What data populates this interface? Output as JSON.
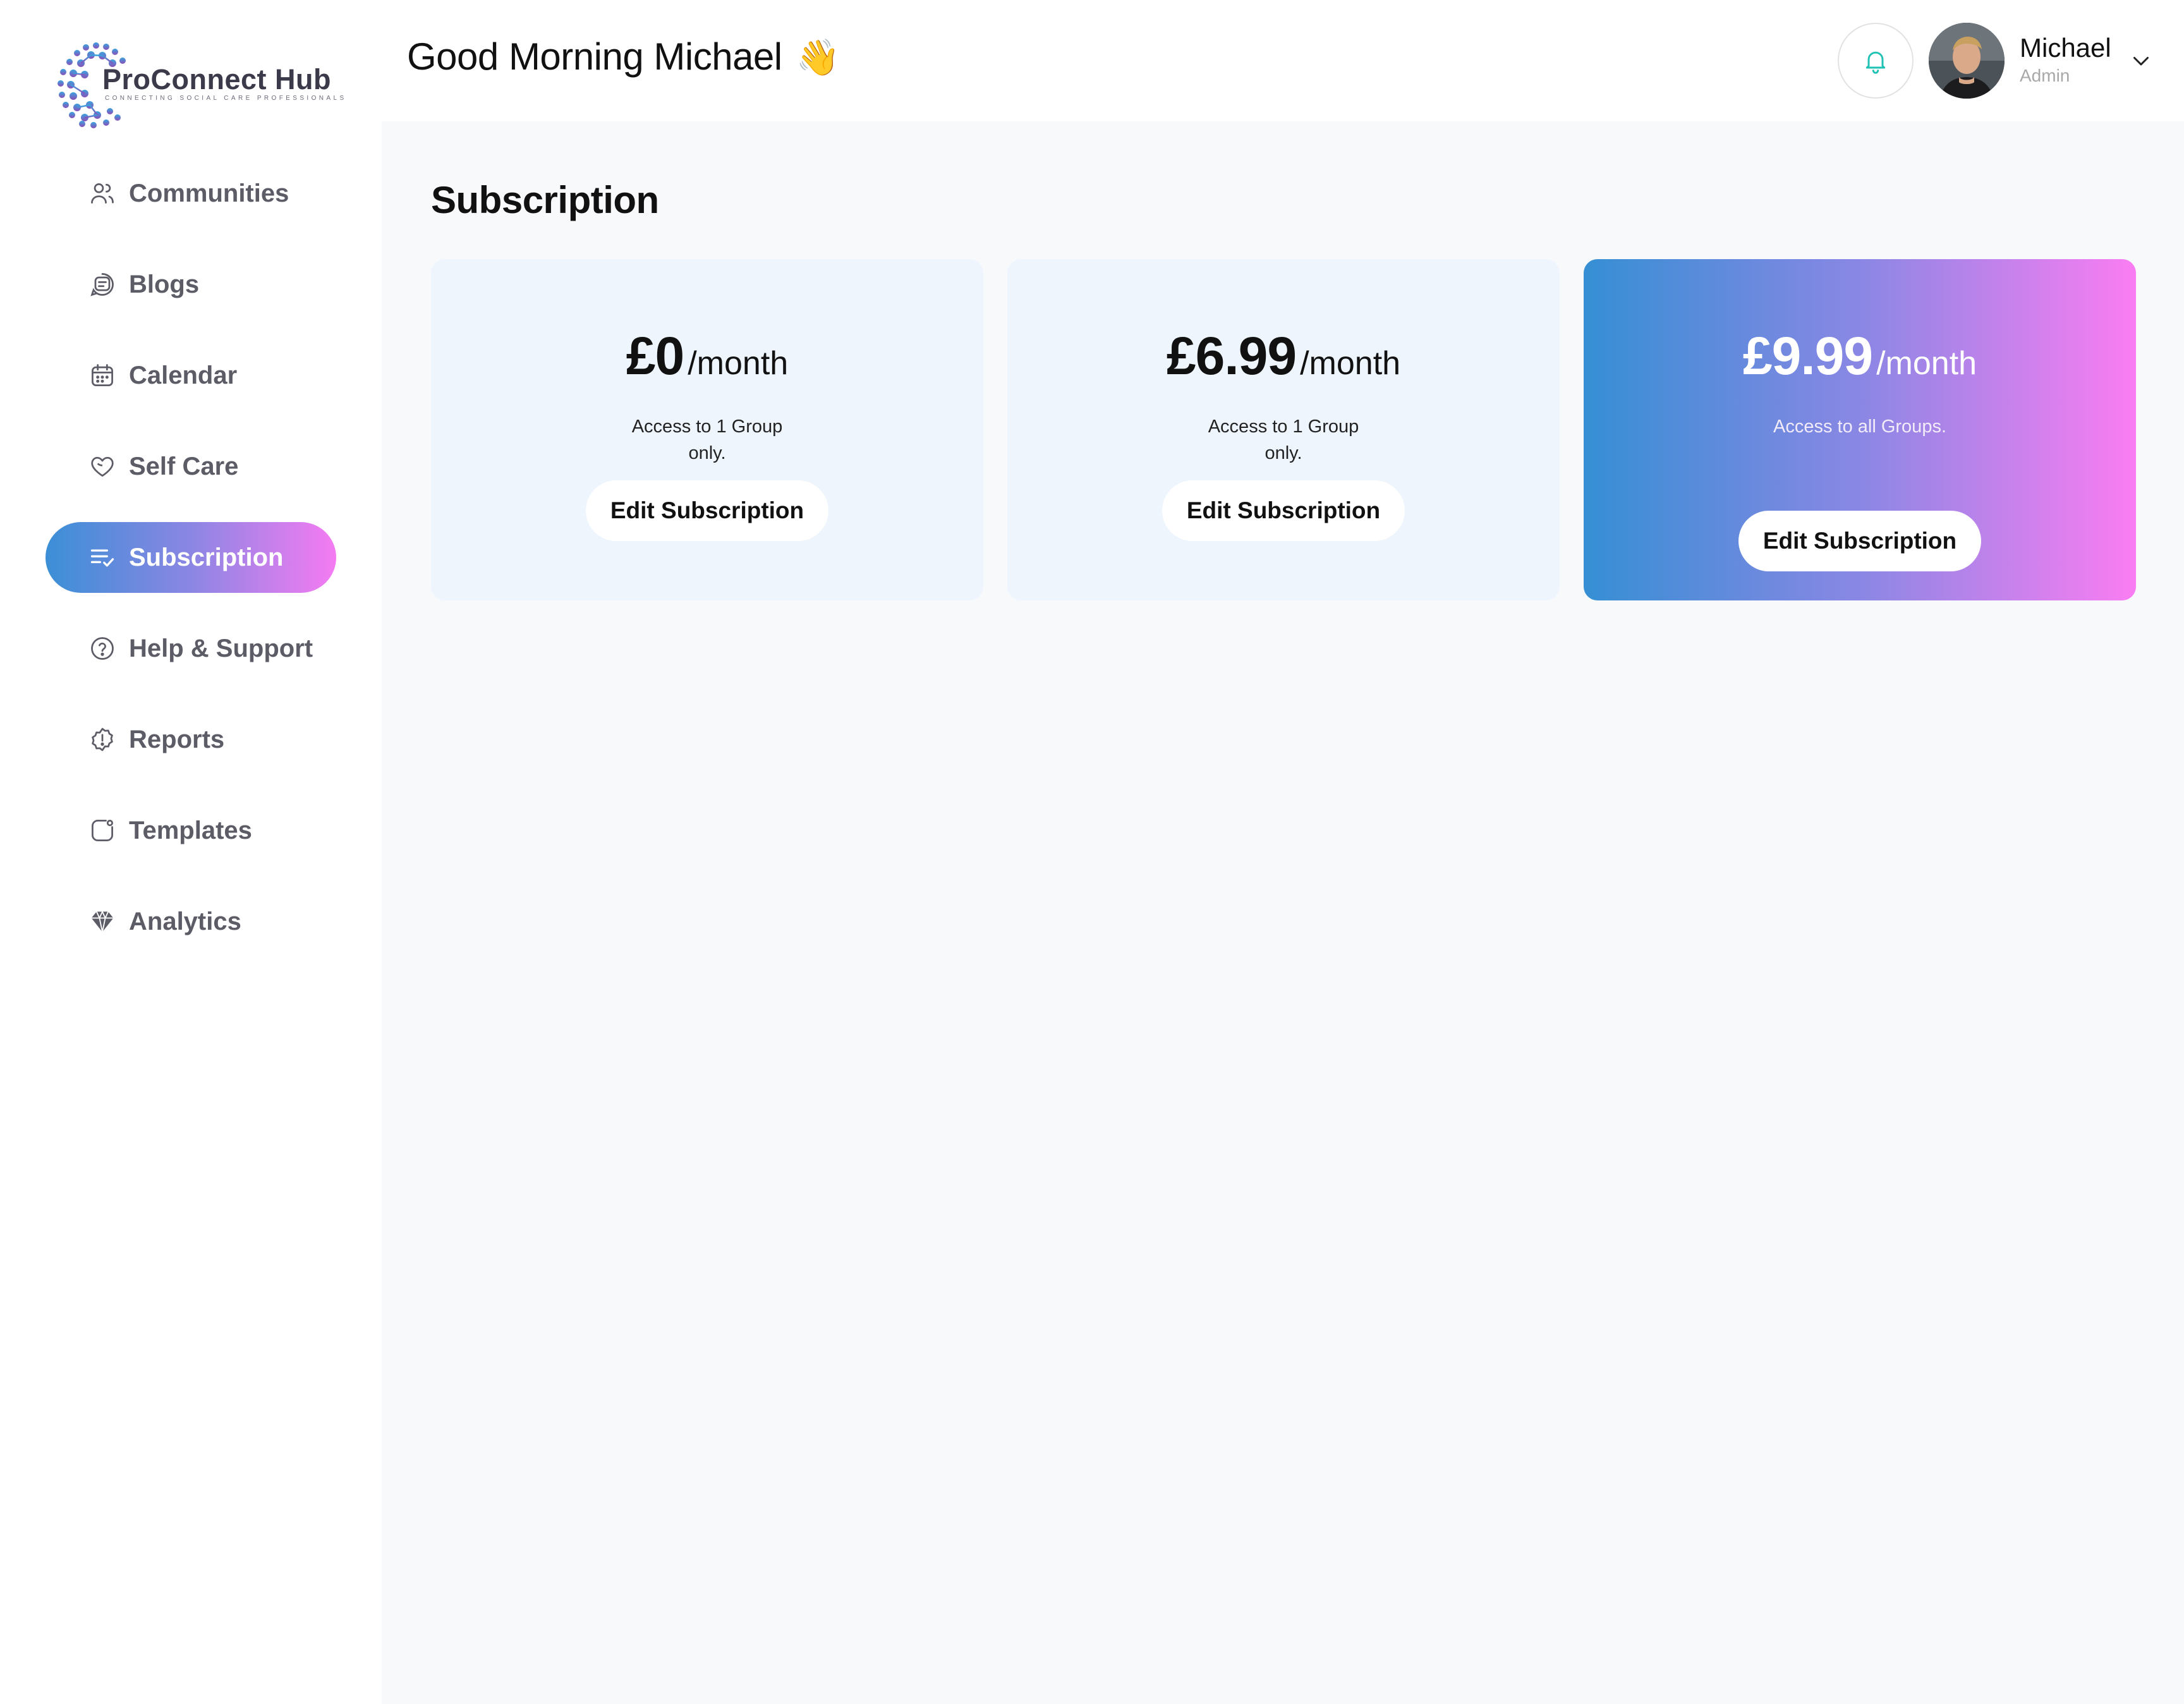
{
  "brand": {
    "name": "ProConnect Hub",
    "tagline": "CONNECTING SOCIAL CARE PROFESSIONALS"
  },
  "sidebar": {
    "items": [
      {
        "label": "Communities",
        "icon": "users-icon",
        "active": false
      },
      {
        "label": "Blogs",
        "icon": "blog-icon",
        "active": false
      },
      {
        "label": "Calendar",
        "icon": "calendar-icon",
        "active": false
      },
      {
        "label": "Self Care",
        "icon": "heart-icon",
        "active": false
      },
      {
        "label": "Subscription",
        "icon": "list-check-icon",
        "active": true
      },
      {
        "label": "Help & Support",
        "icon": "help-circle-icon",
        "active": false
      },
      {
        "label": "Reports",
        "icon": "alert-badge-icon",
        "active": false
      },
      {
        "label": "Templates",
        "icon": "template-icon",
        "active": false
      },
      {
        "label": "Analytics",
        "icon": "diamond-icon",
        "active": false
      }
    ]
  },
  "header": {
    "greeting": "Good Morning Michael",
    "greeting_emoji": "👋",
    "user": {
      "name": "Michael",
      "role": "Admin"
    }
  },
  "main": {
    "title": "Subscription",
    "plans": [
      {
        "amount": "£0",
        "period": "/month",
        "description": "Access to 1 Group only.",
        "button": "Edit Subscription"
      },
      {
        "amount": "£6.99",
        "period": "/month",
        "description": "Access to 1 Group only.",
        "button": "Edit Subscription"
      },
      {
        "amount": "£9.99",
        "period": "/month",
        "description": "Access to all Groups.",
        "button": "Edit Subscription"
      }
    ]
  },
  "colors": {
    "accent_gradient_start": "#3b8fd6",
    "accent_gradient_mid": "#8b86e3",
    "accent_gradient_end": "#f57bf2",
    "bell": "#1fc2b3",
    "card_bg": "#eef5fd",
    "main_bg": "#f8f9fb"
  }
}
